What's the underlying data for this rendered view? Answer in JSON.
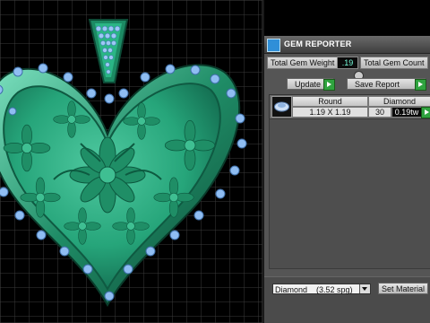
{
  "panel": {
    "title": "GEM REPORTER",
    "total_gem_weight_label": "Total Gem Weight",
    "total_gem_weight_value": ".19",
    "total_gem_count_label": "Total Gem Count",
    "update_label": "Update",
    "save_report_label": "Save Report"
  },
  "table": {
    "headers": [
      "Round",
      "Diamond"
    ],
    "rows": [
      {
        "size": "1.19 X 1.19",
        "count": "30",
        "weight": "0.19tw"
      }
    ]
  },
  "bottom": {
    "material_select": "Diamond    (3.52 spg)",
    "set_material_label": "Set Material"
  },
  "icons": {
    "logo": "gem-reporter-logo-icon",
    "gem_thumbnail": "round-gem-icon",
    "play": "play-arrow-icon"
  },
  "colors": {
    "model_green": "#2fa77a",
    "gem_blue": "#88b8f0",
    "accent_green": "#2fa33f"
  }
}
